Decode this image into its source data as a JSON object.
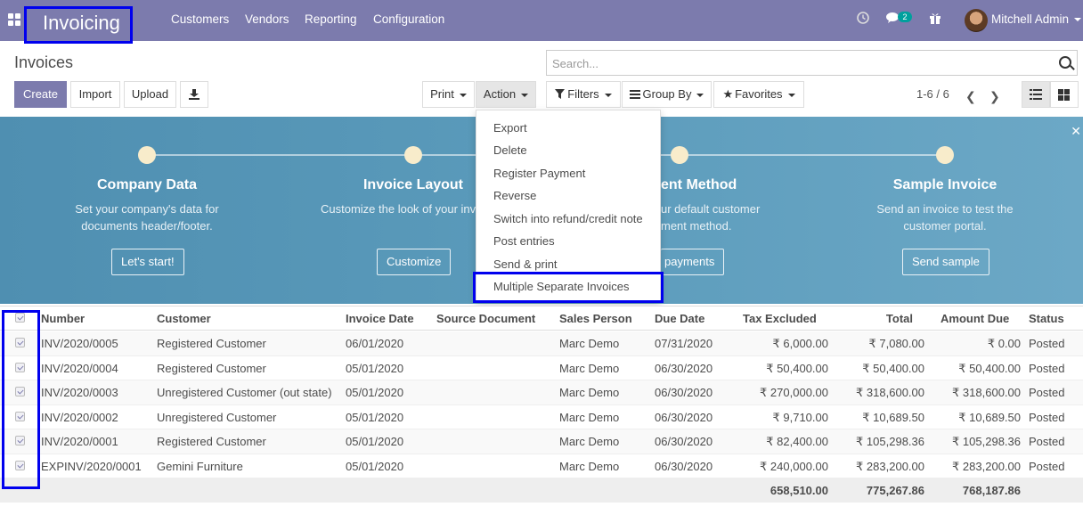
{
  "app": {
    "name": "Invoicing"
  },
  "topmenu": [
    "Customers",
    "Vendors",
    "Reporting",
    "Configuration"
  ],
  "systray": {
    "messages_count": "2",
    "user": "Mitchell Admin"
  },
  "page": {
    "title": "Invoices",
    "search_placeholder": "Search...",
    "pager": "1-6 / 6"
  },
  "buttons": {
    "create": "Create",
    "import": "Import",
    "upload": "Upload",
    "print": "Print",
    "action": "Action",
    "filters": "Filters",
    "groupby": "Group By",
    "favorites": "Favorites"
  },
  "action_menu": [
    "Export",
    "Delete",
    "Register Payment",
    "Reverse",
    "Switch into refund/credit note",
    "Post entries",
    "Send & print",
    "Multiple Separate Invoices"
  ],
  "onboarding": {
    "steps": [
      {
        "title": "Company Data",
        "desc1": "Set your company's data for",
        "desc2": "documents header/footer.",
        "button": "Let's start!"
      },
      {
        "title": "Invoice Layout",
        "desc1": "Customize the look of your inv",
        "desc2": "",
        "button": "Customize"
      },
      {
        "title": "ent Method",
        "desc1": "ur default customer",
        "desc2": "ment method.",
        "button": "payments"
      },
      {
        "title": "Sample Invoice",
        "desc1": "Send an invoice to test the",
        "desc2": "customer portal.",
        "button": "Send sample"
      }
    ]
  },
  "table": {
    "columns": [
      "Number",
      "Customer",
      "Invoice Date",
      "Source Document",
      "Sales Person",
      "Due Date",
      "Tax Excluded",
      "Total",
      "Amount Due",
      "Status"
    ],
    "rows": [
      [
        "INV/2020/0005",
        "Registered Customer",
        "06/01/2020",
        "",
        "Marc Demo",
        "07/31/2020",
        "₹ 6,000.00",
        "₹ 7,080.00",
        "₹ 0.00",
        "Posted"
      ],
      [
        "INV/2020/0004",
        "Registered Customer",
        "05/01/2020",
        "",
        "Marc Demo",
        "06/30/2020",
        "₹ 50,400.00",
        "₹ 50,400.00",
        "₹ 50,400.00",
        "Posted"
      ],
      [
        "INV/2020/0003",
        "Unregistered Customer (out state)",
        "05/01/2020",
        "",
        "Marc Demo",
        "06/30/2020",
        "₹ 270,000.00",
        "₹ 318,600.00",
        "₹ 318,600.00",
        "Posted"
      ],
      [
        "INV/2020/0002",
        "Unregistered Customer",
        "05/01/2020",
        "",
        "Marc Demo",
        "06/30/2020",
        "₹ 9,710.00",
        "₹ 10,689.50",
        "₹ 10,689.50",
        "Posted"
      ],
      [
        "INV/2020/0001",
        "Registered Customer",
        "05/01/2020",
        "",
        "Marc Demo",
        "06/30/2020",
        "₹ 82,400.00",
        "₹ 105,298.36",
        "₹ 105,298.36",
        "Posted"
      ],
      [
        "EXPINV/2020/0001",
        "Gemini Furniture",
        "05/01/2020",
        "",
        "Marc Demo",
        "06/30/2020",
        "₹ 240,000.00",
        "₹ 283,200.00",
        "₹ 283,200.00",
        "Posted"
      ]
    ],
    "totals": {
      "tax_excluded": "658,510.00",
      "total": "775,267.86",
      "amount_due": "768,187.86"
    }
  },
  "colors": {
    "brand": "#7c7bad",
    "highlight": "#0000ee",
    "banner": "#5b9bbb"
  }
}
